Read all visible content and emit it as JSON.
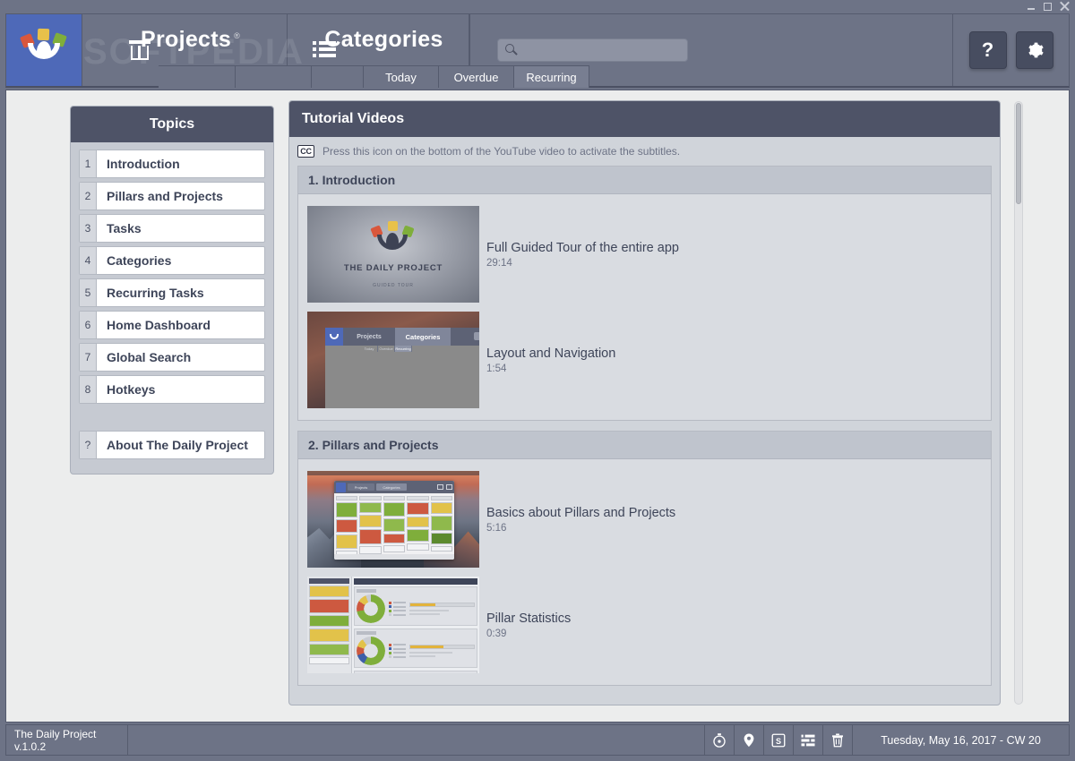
{
  "window": {
    "minimize_label": "minimize",
    "maximize_label": "maximize",
    "close_label": "close",
    "watermark": "SOFTPEDIA"
  },
  "header": {
    "logo_name": "the-daily-project-logo",
    "nav": [
      {
        "label": "Projects",
        "icon": "projects-icon",
        "registered_mark": "®"
      },
      {
        "label": "Categories",
        "icon": "categories-list-icon",
        "registered_mark": ""
      }
    ],
    "subtabs": [
      {
        "label": "Today",
        "active": false
      },
      {
        "label": "Overdue",
        "active": false
      },
      {
        "label": "Recurring",
        "active": true
      }
    ],
    "search": {
      "value": "",
      "placeholder": "",
      "icon": "search-icon"
    },
    "buttons": [
      {
        "label": "?",
        "name": "help-button"
      },
      {
        "label": "",
        "name": "settings-gear-button"
      }
    ]
  },
  "sidebar": {
    "title": "Topics",
    "items": [
      {
        "num": "1",
        "label": "Introduction"
      },
      {
        "num": "2",
        "label": "Pillars and Projects"
      },
      {
        "num": "3",
        "label": "Tasks"
      },
      {
        "num": "4",
        "label": "Categories"
      },
      {
        "num": "5",
        "label": "Recurring Tasks"
      },
      {
        "num": "6",
        "label": "Home Dashboard"
      },
      {
        "num": "7",
        "label": "Global Search"
      },
      {
        "num": "8",
        "label": "Hotkeys"
      }
    ],
    "about": {
      "num": "?",
      "label": "About The Daily Project"
    }
  },
  "main": {
    "title": "Tutorial Videos",
    "cc_icon_text": "CC",
    "cc_note": "Press this icon on the bottom of the YouTube video to activate the subtitles.",
    "sections": [
      {
        "title": "1. Introduction",
        "videos": [
          {
            "title": "Full Guided Tour of the entire app",
            "duration": "29:14",
            "thumb": "logo-splash"
          },
          {
            "title": "Layout and Navigation",
            "duration": "1:54",
            "thumb": "app-window"
          }
        ]
      },
      {
        "title": "2. Pillars and Projects",
        "videos": [
          {
            "title": "Basics about Pillars and Projects",
            "duration": "5:16",
            "thumb": "mac-kanban"
          },
          {
            "title": "Pillar Statistics",
            "duration": "0:39",
            "thumb": "statistics"
          }
        ]
      }
    ],
    "thumb_text": {
      "splash_title": "THE DAILY PROJECT",
      "splash_subtitle": "GUIDED TOUR",
      "app_tab1": "Projects",
      "app_tab2": "Categories",
      "app_sub1": "Today",
      "app_sub2": "Overdue",
      "app_sub3": "Recurring"
    }
  },
  "statusbar": {
    "version": "The Daily Project v.1.0.2",
    "icons": [
      {
        "name": "timer-icon"
      },
      {
        "name": "location-pin-icon"
      },
      {
        "name": "s-box-icon",
        "label": "S"
      },
      {
        "name": "list-settings-icon"
      },
      {
        "name": "trash-icon"
      }
    ],
    "date": "Tuesday, May 16, 2017 - CW 20"
  },
  "colors": {
    "window_chrome": "#6d7386",
    "header_dark": "#4e5367",
    "accent_blue": "#4e69b8",
    "panel_bg": "#d0d4da",
    "body_bg": "#eceded",
    "logo_red": "#d9573c",
    "logo_yellow": "#e8c14a",
    "logo_green": "#7fae3b"
  }
}
